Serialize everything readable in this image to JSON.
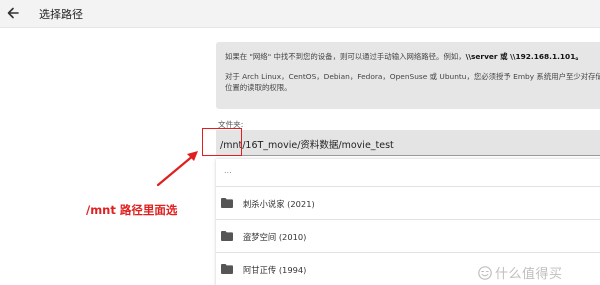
{
  "header": {
    "title": "选择路径",
    "back_icon": "arrow-left-icon"
  },
  "info": {
    "line1_prefix": "如果在 \"网络\" 中找不到您的设备，则可以通过手动输入网络路径。例如，",
    "line1_example": "\\\\server 或 \\\\192.168.1.101。",
    "line2": "对于 Arch Linux，CentOS，Debian，Fedora，OpenSuse 或 Ubuntu，您必须授予 Emby 系统用户至少对存储",
    "line3": "位置的读取的权限。"
  },
  "folder_field": {
    "label": "文件夹:",
    "value": "/mnt/16T_movie/资料数据/movie_test"
  },
  "list": {
    "parent_label": "...",
    "items": [
      {
        "label": "刺杀小说家 (2021)",
        "icon": "folder-icon"
      },
      {
        "label": "盗梦空间 (2010)",
        "icon": "folder-icon"
      },
      {
        "label": "阿甘正传 (1994)",
        "icon": "folder-icon"
      }
    ]
  },
  "annotation": {
    "text": "/mnt 路径里面选",
    "color": "#e02020"
  },
  "watermark": {
    "text": "什么值得买",
    "icon": "smzdm-logo-icon"
  },
  "colors": {
    "header_bg": "#f3f3f3",
    "info_bg": "#e6e6e6",
    "input_bg": "#e4e4e4",
    "annotation_red": "#e02020",
    "folder_icon": "#555555"
  }
}
